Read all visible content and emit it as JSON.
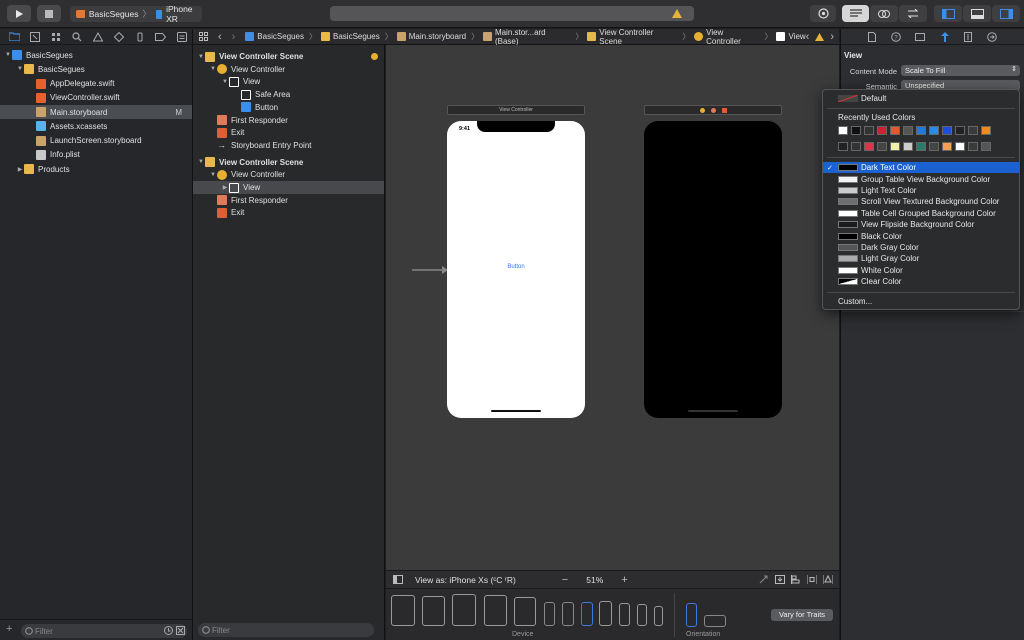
{
  "toolbar": {
    "scheme": "BasicSegues",
    "device": "iPhone XR",
    "warning_icon": "warning-icon"
  },
  "jumpbar": {
    "crumbs": [
      "BasicSegues",
      "BasicSegues",
      "Main.storyboard",
      "Main.stor...ard (Base)",
      "View Controller Scene",
      "View Controller",
      "View"
    ]
  },
  "navigator": {
    "items": [
      {
        "label": "BasicSegues",
        "level": 0,
        "kind": "project",
        "expanded": true
      },
      {
        "label": "BasicSegues",
        "level": 1,
        "kind": "folder",
        "expanded": true
      },
      {
        "label": "AppDelegate.swift",
        "level": 2,
        "kind": "swift"
      },
      {
        "label": "ViewController.swift",
        "level": 2,
        "kind": "swift"
      },
      {
        "label": "Main.storyboard",
        "level": 2,
        "kind": "storyboard",
        "selected": true,
        "badge": "M"
      },
      {
        "label": "Assets.xcassets",
        "level": 2,
        "kind": "assets"
      },
      {
        "label": "LaunchScreen.storyboard",
        "level": 2,
        "kind": "storyboard"
      },
      {
        "label": "Info.plist",
        "level": 2,
        "kind": "plist"
      },
      {
        "label": "Products",
        "level": 1,
        "kind": "folder",
        "expanded": false
      }
    ],
    "filter_placeholder": "Filter"
  },
  "outline": {
    "rows": [
      {
        "label": "View Controller Scene",
        "level": 0,
        "kind": "scene",
        "tri": "down",
        "header": true
      },
      {
        "label": "View Controller",
        "level": 1,
        "kind": "vc",
        "tri": "down"
      },
      {
        "label": "View",
        "level": 2,
        "kind": "view",
        "tri": "down"
      },
      {
        "label": "Safe Area",
        "level": 3,
        "kind": "safearea"
      },
      {
        "label": "Button",
        "level": 3,
        "kind": "button"
      },
      {
        "label": "First Responder",
        "level": 1,
        "kind": "responder"
      },
      {
        "label": "Exit",
        "level": 1,
        "kind": "exit"
      },
      {
        "label": "Storyboard Entry Point",
        "level": 1,
        "kind": "entry"
      },
      {
        "label": "View Controller Scene",
        "level": 0,
        "kind": "scene",
        "tri": "down",
        "header": true
      },
      {
        "label": "View Controller",
        "level": 1,
        "kind": "vc",
        "tri": "down"
      },
      {
        "label": "View",
        "level": 2,
        "kind": "view",
        "tri": "right",
        "selected": true
      },
      {
        "label": "First Responder",
        "level": 1,
        "kind": "responder"
      },
      {
        "label": "Exit",
        "level": 1,
        "kind": "exit"
      }
    ],
    "filter_placeholder": "Filter"
  },
  "canvas": {
    "scene1_title": "View Controller",
    "status_time": "9:41",
    "button_label": "Button",
    "view_as": "View as: iPhone Xs (ᶜC ʳR)",
    "zoom": "51%",
    "device_label": "Device",
    "orientation_label": "Orientation",
    "vary_button": "Vary for Traits"
  },
  "inspector": {
    "section": "View",
    "content_mode_label": "Content Mode",
    "content_mode_value": "Scale To Fill",
    "semantic_label": "Semantic",
    "semantic_value": "Unspecified"
  },
  "color_menu": {
    "default_label": "Default",
    "recent_header": "Recently Used Colors",
    "recent_row1": [
      "#ffffff",
      "#111111",
      "#333333",
      "#cc2233",
      "#e05a2b",
      "#555555",
      "#1f7ae0",
      "#2a8ce6",
      "#1c4fe0",
      "#222222",
      "#3a3a3a",
      "#f08a1c"
    ],
    "recent_row2": [
      "#222222",
      "#333333",
      "#d9364a",
      "#444444",
      "#f1f0a8",
      "#cccccc",
      "#2d7a6a",
      "#444444",
      "#f3a052",
      "#ffffff",
      "#3a3a3a",
      "#555555"
    ],
    "items": [
      {
        "label": "Dark Text Color",
        "swatch": "#000000",
        "checked": true,
        "highlighted": true
      },
      {
        "label": "Group Table View Background Color",
        "swatch": "#f2f2f7"
      },
      {
        "label": "Light Text Color",
        "swatch": "#cccccc"
      },
      {
        "label": "Scroll View Textured Background Color",
        "swatch": "#6e6e6e"
      },
      {
        "label": "Table Cell Grouped Background Color",
        "swatch": "#ffffff"
      },
      {
        "label": "View Flipside Background Color",
        "swatch": "#1c1c1e"
      },
      {
        "label": "Black Color",
        "swatch": "#000000"
      },
      {
        "label": "Dark Gray Color",
        "swatch": "#555555"
      },
      {
        "label": "Light Gray Color",
        "swatch": "#aaaaaa"
      },
      {
        "label": "White Color",
        "swatch": "#ffffff"
      },
      {
        "label": "Clear Color",
        "swatch": "clear"
      }
    ],
    "custom_label": "Custom..."
  }
}
